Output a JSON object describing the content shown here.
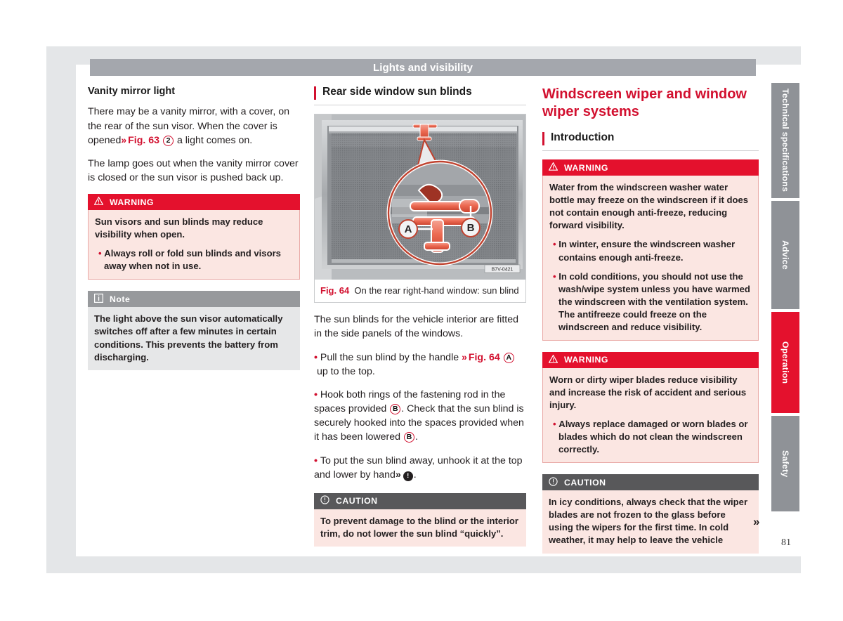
{
  "header": {
    "running_title": "Lights and visibility"
  },
  "left_column": {
    "heading": "Vanity mirror light",
    "paragraph_1_a": "There may be a vanity mirror, with a cover, on the rear of the sun visor. When the cover is opened",
    "paragraph_1_ref": "Fig. 63",
    "paragraph_1_marker": "2",
    "paragraph_1_b": "a light comes on.",
    "paragraph_2": "The lamp goes out when the vanity mirror cover is closed or the sun visor is pushed back up.",
    "warning": {
      "label": "WARNING",
      "icon": "warning-triangle-icon",
      "text": "Sun visors and sun blinds may reduce visibility when open.",
      "bullets": [
        "Always roll or fold sun blinds and visors away when not in use."
      ]
    },
    "note": {
      "label": "Note",
      "icon": "info-icon",
      "text": "The light above the sun visor automatically switches off after a few minutes in certain conditions. This prevents the battery from discharging."
    }
  },
  "middle_column": {
    "heading": "Rear side window sun blinds",
    "figure": {
      "number": "Fig. 64",
      "caption": "On the rear right-hand window: sun blind",
      "image_code": "B7V-0421",
      "callout_a": "A",
      "callout_b": "B"
    },
    "paragraph_1": "The sun blinds for the vehicle interior are fitted in the side panels of the windows.",
    "bullet_1_a": "Pull the sun blind by the handle",
    "bullet_1_ref": "Fig. 64",
    "bullet_1_marker": "A",
    "bullet_1_b": "up to the top.",
    "bullet_2_a": "Hook both rings of the fastening rod in the spaces provided",
    "bullet_2_marker_1": "B",
    "bullet_2_b": ". Check that the sun blind is securely hooked into the spaces provided when it has been lowered",
    "bullet_2_marker_2": "B",
    "bullet_2_c": ".",
    "bullet_3_a": "To put the sun blind away, unhook it at the top and lower by hand",
    "bullet_3_marker": "!",
    "caution": {
      "label": "CAUTION",
      "icon": "caution-circle-icon",
      "text": "To prevent damage to the blind or the interior trim, do not lower the sun blind “quickly”."
    }
  },
  "right_column": {
    "chapter_title": "Windscreen wiper and window wiper systems",
    "section_heading": "Introduction",
    "warning_1": {
      "label": "WARNING",
      "icon": "warning-triangle-icon",
      "text": "Water from the windscreen washer water bottle may freeze on the windscreen if it does not contain enough anti-freeze, reducing forward visibility.",
      "bullets": [
        "In winter, ensure the windscreen washer contains enough anti-freeze.",
        "In cold conditions, you should not use the wash/wipe system unless you have warmed the windscreen with the ventilation system. The antifreeze could freeze on the windscreen and reduce visibility."
      ]
    },
    "warning_2": {
      "label": "WARNING",
      "icon": "warning-triangle-icon",
      "text": "Worn or dirty wiper blades reduce visibility and increase the risk of accident and serious injury.",
      "bullets": [
        "Always replace damaged or worn blades or blades which do not clean the windscreen correctly."
      ]
    },
    "caution": {
      "label": "CAUTION",
      "icon": "caution-circle-icon",
      "text": "In icy conditions, always check that the wiper blades are not frozen to the glass before using the wipers for the first time. In cold weather, it may help to leave the vehicle"
    },
    "continuation_marker": "»"
  },
  "side_tabs": [
    {
      "label": "Technical specifications",
      "active": false
    },
    {
      "label": "Advice",
      "active": false
    },
    {
      "label": "Operation",
      "active": true
    },
    {
      "label": "Safety",
      "active": false
    }
  ],
  "page_number": "81",
  "colors": {
    "brand_red": "#d2102f",
    "warning_red": "#e4112d",
    "warning_bg": "#fbe6e2",
    "caution_header": "#58585a",
    "note_header": "#97999c",
    "note_bg": "#e6e7e8",
    "header_band": "#a4a7ad",
    "tab_grey": "#8f9297"
  }
}
